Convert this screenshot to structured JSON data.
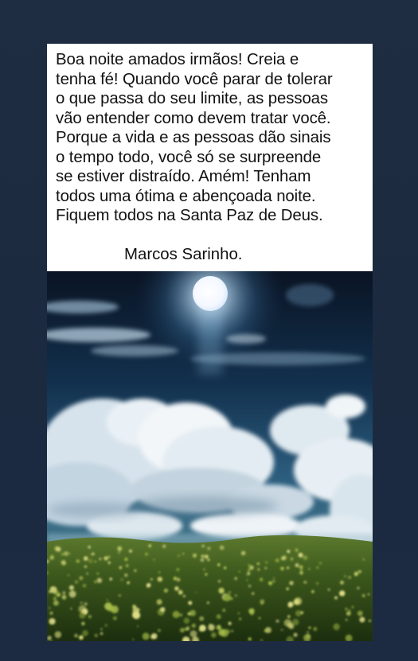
{
  "post": {
    "message": "Boa noite amados irmãos! Creia e\ntenha fé! Quando você parar de tolerar\no que passa do seu limite, as pessoas\nvão entender como devem tratar você.\nPorque a vida e as pessoas dão sinais\no tempo todo, você só se surpreende\nse estiver distraído. Amém! Tenham\ntodos uma ótima e abençoada noite.\nFiquem todos na Santa Paz de Deus.",
    "signature": "Marcos Sarinho.",
    "image_description": "night-sky-moon-clouds-meadow"
  },
  "colors": {
    "background": "#1f2d42",
    "card": "#ffffff",
    "text": "#111111",
    "sky_dark": "#0b1626",
    "sky_mid": "#2c5a7e",
    "meadow": "#3c5a1e"
  }
}
